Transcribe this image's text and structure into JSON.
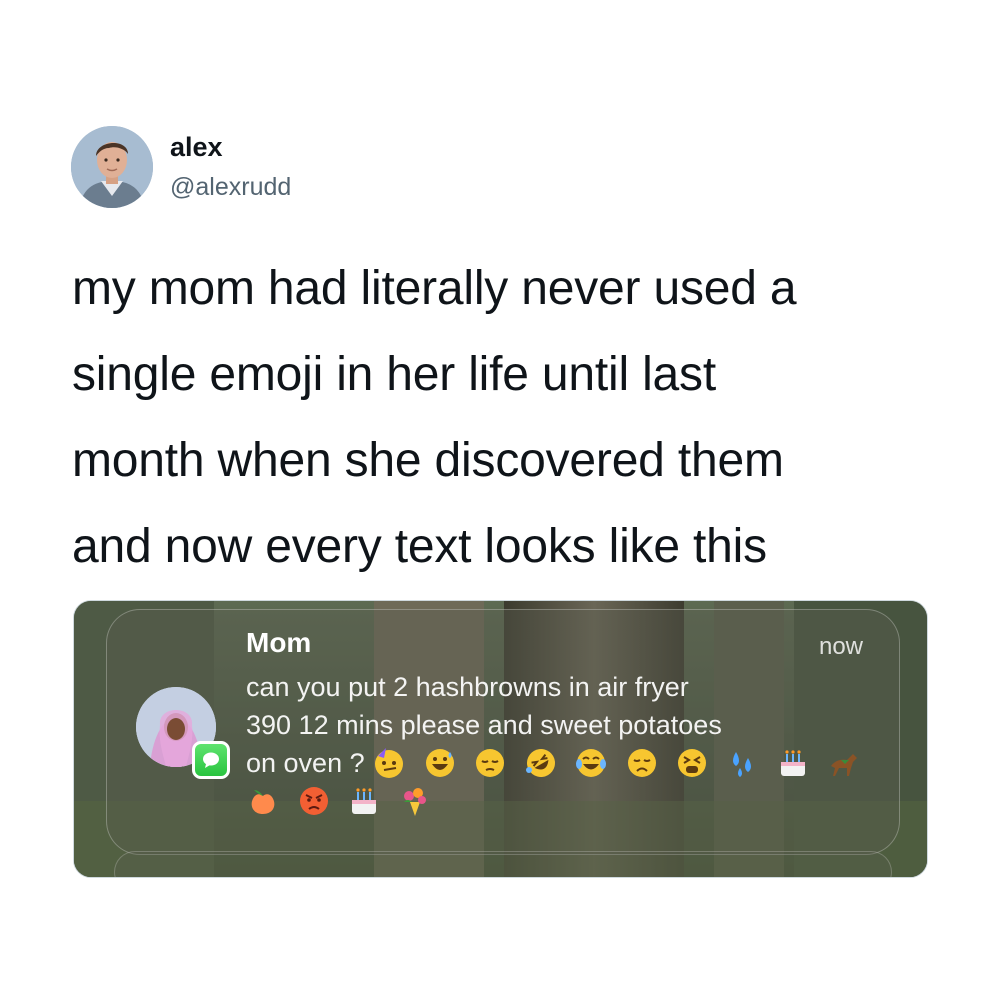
{
  "tweet": {
    "display_name": "alex",
    "handle": "@alexrudd",
    "text_lines": [
      "my mom had literally never used a",
      "single emoji in her life until last",
      "month when she discovered them",
      "and now every text looks like this"
    ]
  },
  "notification": {
    "sender": "Mom",
    "time": "now",
    "message_lines": [
      "can you put 2 hashbrowns in air fryer",
      "390 12 mins please and sweet potatoes",
      "on oven ?"
    ],
    "emojis_row1": [
      "partying-face-icon",
      "grinning-sweat-icon",
      "pensive-face-icon",
      "rofl-icon",
      "tears-of-joy-icon",
      "disappointed-face-icon",
      "tired-face-icon",
      "sweat-droplets-icon",
      "birthday-cake-icon",
      "racehorse-icon"
    ],
    "emojis_row2": [
      "peach-icon",
      "angry-face-icon",
      "birthday-cake-icon",
      "bouquet-icon"
    ],
    "colors": {
      "badge_green": "#29c43f",
      "notification_text": "#ffffff"
    }
  }
}
